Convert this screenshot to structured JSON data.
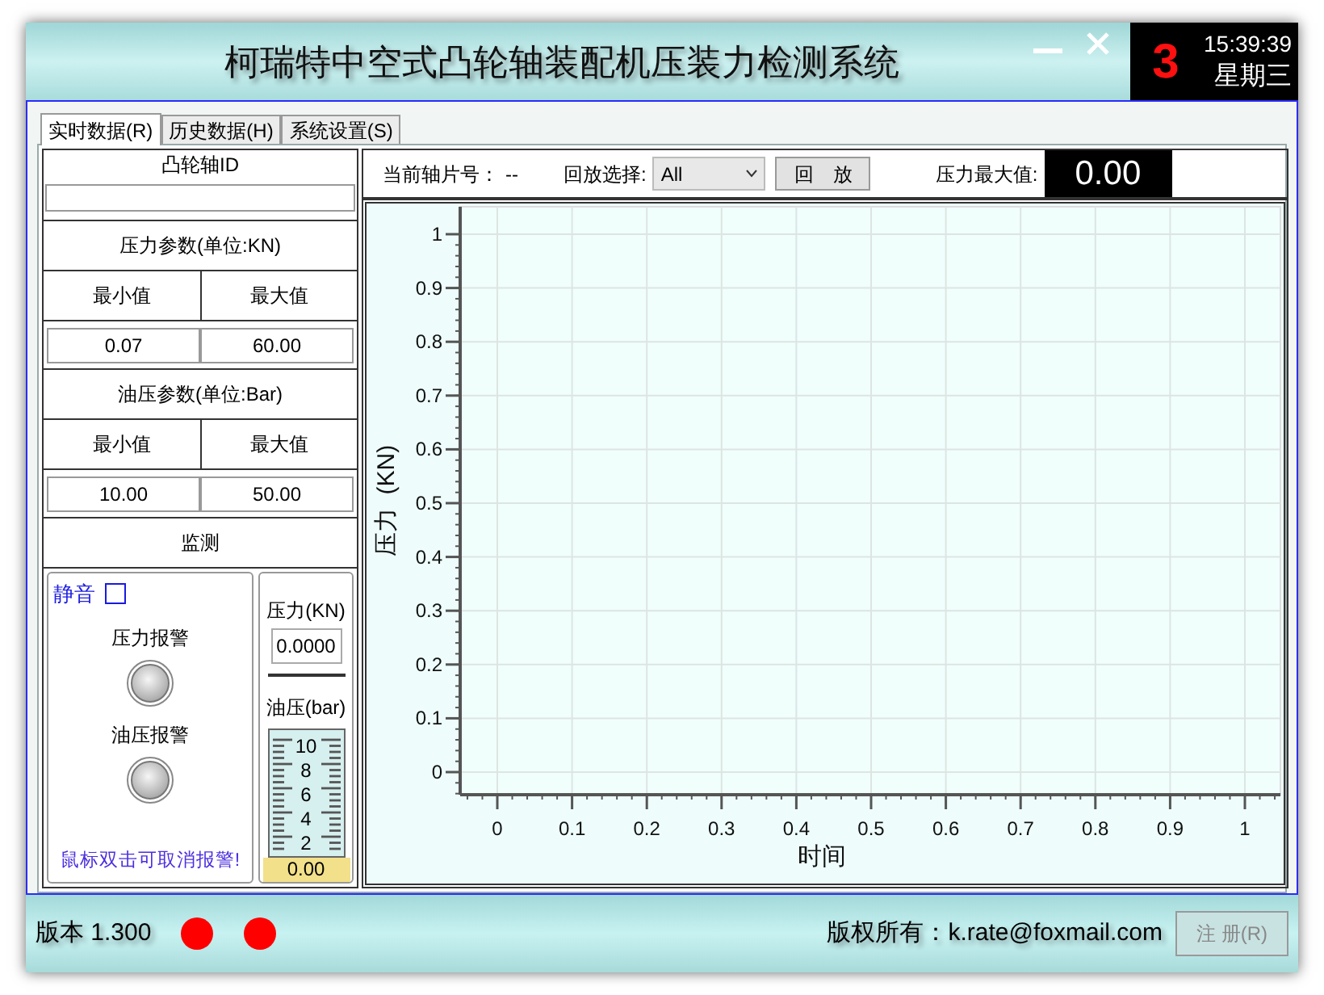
{
  "window": {
    "title": "柯瑞特中空式凸轮轴装配机压装力检测系统"
  },
  "clock": {
    "day_number": "3",
    "time": "15:39:39",
    "weekday": "星期三"
  },
  "tabs": [
    {
      "label": "实时数据(R)",
      "selected": true
    },
    {
      "label": "历史数据(H)",
      "selected": false
    },
    {
      "label": "系统设置(S)",
      "selected": false
    }
  ],
  "camshaft_id": {
    "label": "凸轮轴ID"
  },
  "pressure_params": {
    "title": "压力参数(单位:KN)",
    "min_label": "最小值",
    "max_label": "最大值",
    "min": "0.07",
    "max": "60.00"
  },
  "oil_params": {
    "title": "油压参数(单位:Bar)",
    "min_label": "最小值",
    "max_label": "最大值",
    "min": "10.00",
    "max": "50.00"
  },
  "monitor": {
    "title": "监测",
    "mute": {
      "label": "静音",
      "checked": false
    },
    "alarms": [
      {
        "label": "压力报警",
        "on": false
      },
      {
        "label": "油压报警",
        "on": false
      }
    ],
    "hint": "鼠标双击可取消报警!",
    "pressure": {
      "label": "压力(KN)",
      "value": "0.0000"
    },
    "oil": {
      "label": "油压(bar)",
      "scale": [
        "10",
        "8",
        "6",
        "4",
        "2"
      ],
      "reading": "0.00"
    }
  },
  "toolbar": {
    "shaft_label": "当前轴片号：",
    "shaft_value": "--",
    "replay_label": "回放选择:",
    "replay_value": "All",
    "replay_button": "回　放",
    "max_label": "压力最大值:",
    "max_value": "0.00"
  },
  "chart_data": {
    "type": "line",
    "grid": true,
    "xlabel": "时间",
    "ylabel": "压力  (KN)",
    "xlim": [
      0,
      1
    ],
    "ylim": [
      0,
      1
    ],
    "xticks": [
      0,
      0.1,
      0.2,
      0.3,
      0.4,
      0.5,
      0.6,
      0.7,
      0.8,
      0.9,
      1
    ],
    "yticks": [
      0,
      0.1,
      0.2,
      0.3,
      0.4,
      0.5,
      0.6,
      0.7,
      0.8,
      0.9,
      1
    ]
  },
  "status_bar": {
    "version": "版本 1.300",
    "indicators": [
      {
        "on": true
      },
      {
        "on": true
      }
    ],
    "copyright": "版权所有：k.rate@foxmail.com",
    "register_button": "注 册(R)"
  }
}
